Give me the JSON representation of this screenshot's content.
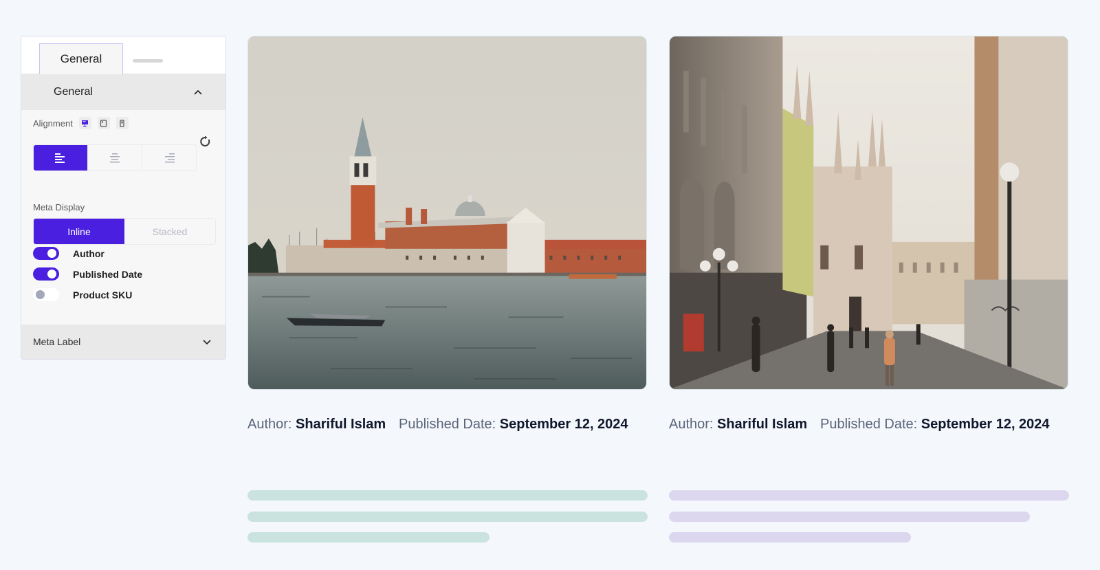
{
  "panel": {
    "tabs": [
      {
        "label": "General",
        "active": true
      },
      {
        "label": "",
        "active": false
      }
    ],
    "general_section": {
      "title": "General",
      "expanded": true,
      "alignment": {
        "label": "Alignment",
        "devices": [
          {
            "name": "desktop",
            "icon": "desktop-icon",
            "active": true
          },
          {
            "name": "tablet",
            "icon": "tablet-icon",
            "active": false
          },
          {
            "name": "mobile",
            "icon": "mobile-icon",
            "active": false
          }
        ],
        "options": [
          {
            "name": "left",
            "icon": "align-left-icon",
            "active": true
          },
          {
            "name": "center",
            "icon": "align-center-icon",
            "active": false
          },
          {
            "name": "right",
            "icon": "align-right-icon",
            "active": false
          }
        ],
        "reset_icon": "reset-icon"
      },
      "meta_display": {
        "label": "Meta Display",
        "options": [
          {
            "label": "Inline",
            "active": true
          },
          {
            "label": "Stacked",
            "active": false
          }
        ]
      },
      "toggles": [
        {
          "label": "Author",
          "on": true
        },
        {
          "label": "Published Date",
          "on": true
        },
        {
          "label": "Product SKU",
          "on": false
        }
      ]
    },
    "meta_label_section": {
      "title": "Meta Label",
      "expanded": false
    }
  },
  "cards": [
    {
      "image_alt": "Venice waterfront with San Giorgio Maggiore church and boats",
      "author_key": "Author:",
      "author_value": "Shariful Islam",
      "date_key": "Published Date:",
      "date_value": "September 12, 2024",
      "placeholder_lines": 3
    },
    {
      "image_alt": "Milan street leading to the Duomo cathedral with pedestrians",
      "author_key": "Author:",
      "author_value": "Shariful Islam",
      "date_key": "Published Date:",
      "date_value": "September 12, 2024",
      "placeholder_lines": 3
    }
  ],
  "colors": {
    "accent": "#4a1fe0",
    "page_bg": "#f4f7fc",
    "panel_bg": "#f7f7f7",
    "section_header_bg": "#e9e9e9",
    "card1_placeholder": "#cbe3de",
    "card2_placeholder": "#dcd7ef"
  }
}
